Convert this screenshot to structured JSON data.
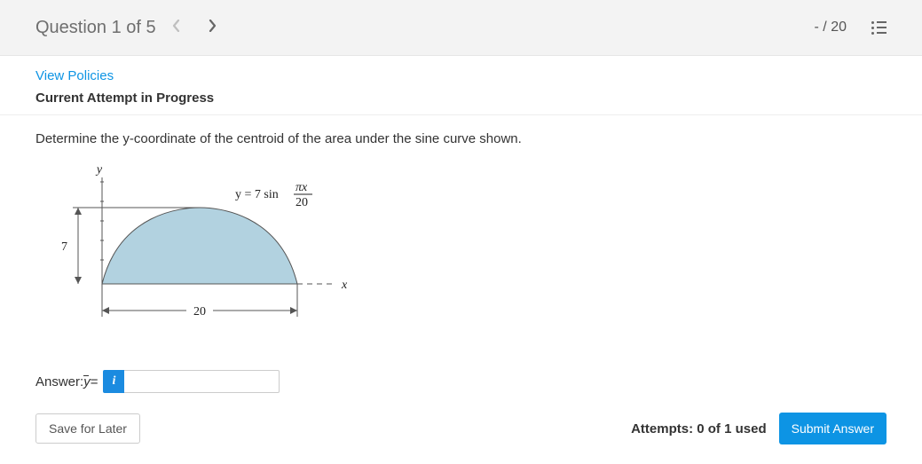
{
  "header": {
    "question_label": "Question 1 of 5",
    "score_current": "-",
    "score_sep": " / ",
    "score_total": "20"
  },
  "links": {
    "view_policies": "View Policies"
  },
  "status": {
    "attempt_header": "Current Attempt in Progress"
  },
  "question": {
    "prompt": "Determine the y-coordinate of the centroid of the area under the sine curve shown."
  },
  "figure": {
    "y_axis_label": "y",
    "x_axis_label": "x",
    "height_label": "7",
    "width_label": "20",
    "equation_prefix": "y = 7 sin",
    "equation_frac_top": "πx",
    "equation_frac_bottom": "20"
  },
  "answer": {
    "label_prefix": "Answer: ",
    "symbol": "y",
    "equals": " = ",
    "info_icon": "i",
    "value": "",
    "placeholder": ""
  },
  "footer": {
    "save_label": "Save for Later",
    "attempts_label": "Attempts: 0 of 1 used",
    "submit_label": "Submit Answer"
  }
}
